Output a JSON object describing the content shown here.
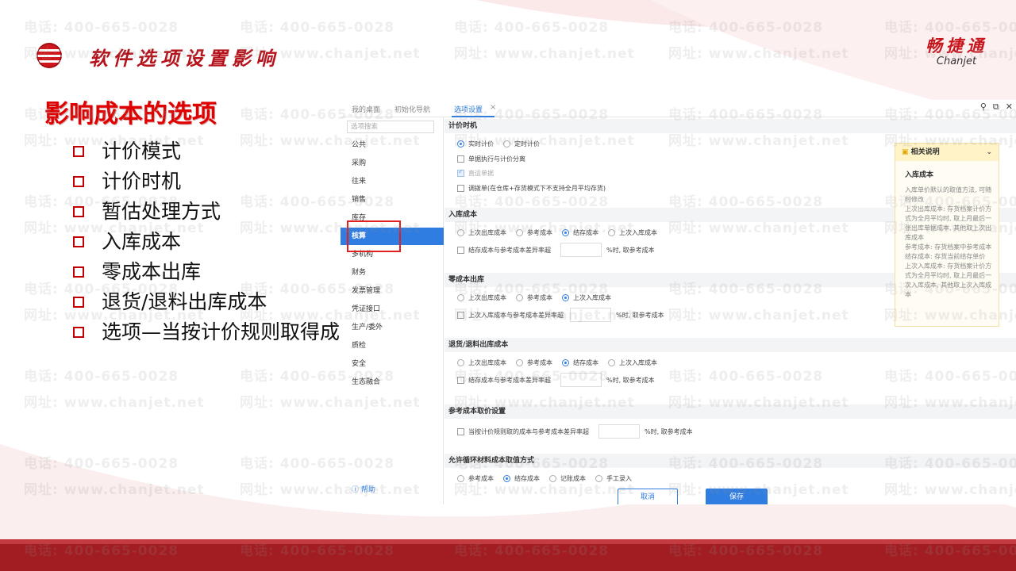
{
  "header": {
    "title": "软件选项设置影响",
    "brand_cn": "畅捷通",
    "brand_en": "Chanjet"
  },
  "section_title": "影响成本的选项",
  "bullets": [
    "计价模式",
    "计价时机",
    "暂估处理方式",
    "入库成本",
    "零成本出库",
    "退货/退料出库成本",
    "选项—当按计价规则取得成本"
  ],
  "watermark": {
    "line1": "电话: 400-665-0028",
    "line2": "网址: www.chanjet.net"
  },
  "app": {
    "tabs": [
      "我的桌面",
      "初始化导航",
      "选项设置"
    ],
    "search_placeholder": "选项搜索",
    "nav": [
      "公共",
      "采购",
      "往来",
      "销售",
      "库存",
      "核算",
      "多机构",
      "财务",
      "发票管理",
      "凭证接口",
      "生产/委外",
      "质检",
      "安全",
      "生态融合"
    ],
    "help_link": "帮助",
    "sections": {
      "timing": {
        "title": "计价时机",
        "radios": [
          "实时计价",
          "定时计价"
        ],
        "checks": [
          "单据执行与计价分离",
          "直运单据",
          "调拨单(在仓库+存货模式下不支持全月平均存货)"
        ]
      },
      "inbound": {
        "title": "入库成本",
        "radios": [
          "上次出库成本",
          "参考成本",
          "结存成本",
          "上次入库成本"
        ],
        "check": "结存成本与参考成本差异率超",
        "suffix": "%时, 取参考成本"
      },
      "zero": {
        "title": "零成本出库",
        "radios": [
          "上次出库成本",
          "参考成本",
          "上次入库成本"
        ],
        "check": "上次入库成本与参考成本差异率超",
        "suffix": "%时, 取参考成本"
      },
      "returns": {
        "title": "退货/退料出库成本",
        "radios": [
          "上次出库成本",
          "参考成本",
          "结存成本",
          "上次入库成本"
        ],
        "check": "结存成本与参考成本差异率超",
        "suffix": "%时, 取参考成本"
      },
      "reference": {
        "title": "参考成本取价设置",
        "check": "当按计价规则取的成本与参考成本差异率超",
        "suffix": "%时, 取参考成本"
      },
      "circular": {
        "title": "允许循环材料成本取值方式",
        "radios": [
          "参考成本",
          "结存成本",
          "记账成本",
          "手工录入"
        ]
      }
    },
    "help_panel": {
      "header": "相关说明",
      "title": "入库成本",
      "body": "入库单价默认的取值方法, 可随时修改\n上次出库成本: 存货档案计价方式为全月平均时, 取上月最后一张出库单据成本, 其他取上次出库成本\n参考成本: 存货档案中参考成本\n结存成本: 存货当前结存单价\n上次入库成本: 存货档案计价方式为全月平均时, 取上月最后一次入库成本, 其他取上次入库成本"
    },
    "buttons": {
      "cancel": "取消",
      "save": "保存"
    }
  },
  "colors": {
    "brand_red": "#c8161d",
    "accent_blue": "#2f7de1",
    "footer": "#a11d22"
  }
}
